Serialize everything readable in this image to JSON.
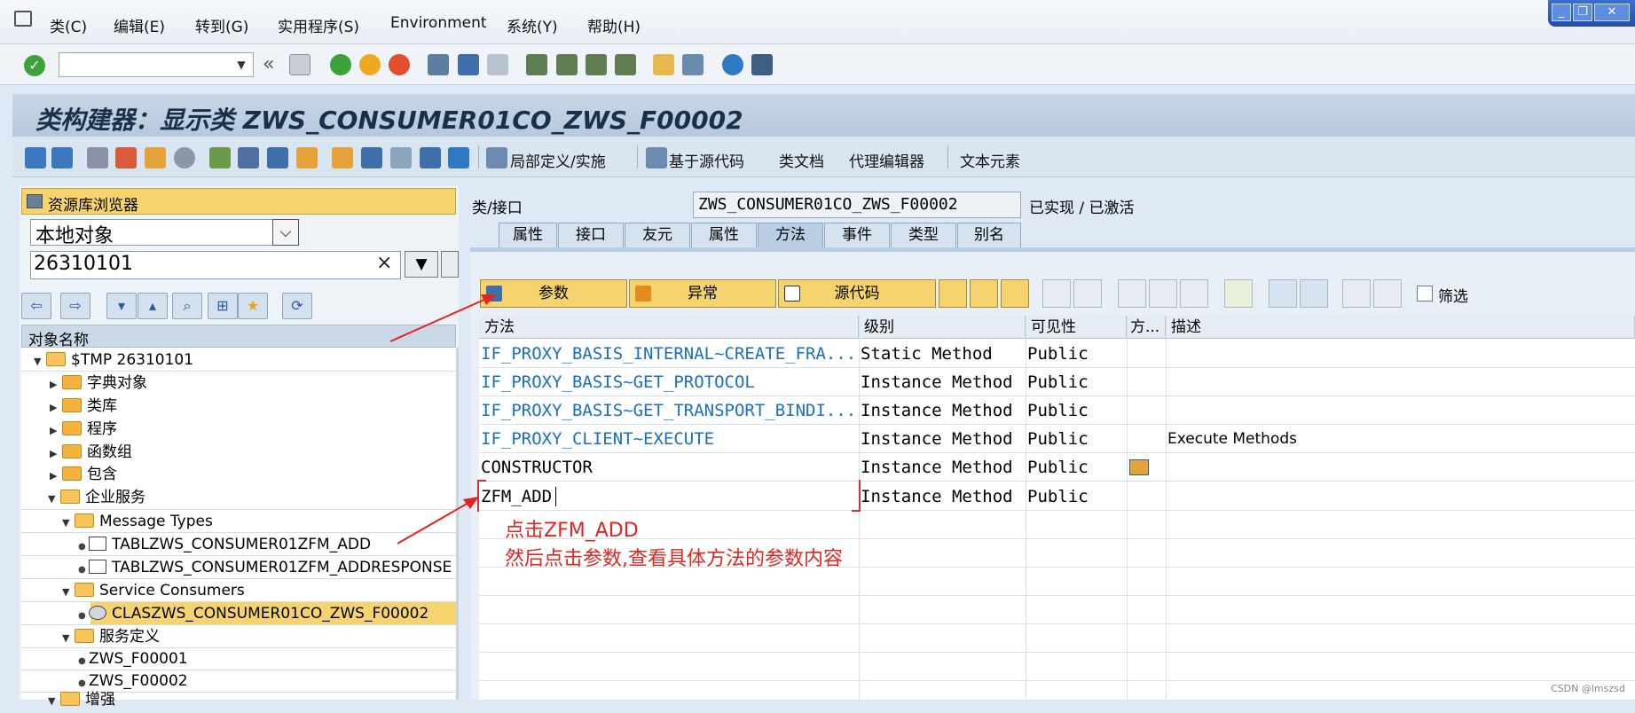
{
  "menu": [
    {
      "label": "类(C)"
    },
    {
      "label": "编辑(E)"
    },
    {
      "label": "转到(G)"
    },
    {
      "label": "实用程序(S)"
    },
    {
      "label": "Environment"
    },
    {
      "label": "系统(Y)"
    },
    {
      "label": "帮助(H)"
    }
  ],
  "title": "类构建器：显示类 ZWS_CONSUMER01CO_ZWS_F00002",
  "app_toolbar": {
    "local_def": "局部定义/实施",
    "source_based": "基于源代码",
    "class_doc": "类文档",
    "proxy_editor": "代理编辑器",
    "text_elements": "文本元素"
  },
  "repo_browser": {
    "title": "资源库浏览器",
    "object_type": "本地对象",
    "search_value": "26310101",
    "clear_glyph": "×",
    "column_header": "对象名称",
    "tree": [
      {
        "label": "$TMP 26310101"
      },
      {
        "label": "字典对象"
      },
      {
        "label": "类库"
      },
      {
        "label": "程序"
      },
      {
        "label": "函数组"
      },
      {
        "label": "包含"
      },
      {
        "label": "企业服务"
      },
      {
        "label": "Message Types"
      },
      {
        "label": "TABLZWS_CONSUMER01ZFM_ADD"
      },
      {
        "label": "TABLZWS_CONSUMER01ZFM_ADDRESPONSE"
      },
      {
        "label": "Service Consumers"
      },
      {
        "label": "CLASZWS_CONSUMER01CO_ZWS_F00002"
      },
      {
        "label": "服务定义"
      },
      {
        "label": "ZWS_F00001"
      },
      {
        "label": "ZWS_F00002"
      },
      {
        "label": "增强"
      }
    ]
  },
  "class_header": {
    "label": "类/接口",
    "value": "ZWS_CONSUMER01CO_ZWS_F00002",
    "status": "已实现 / 已激活"
  },
  "tabs": [
    {
      "label": "属性"
    },
    {
      "label": "接口"
    },
    {
      "label": "友元"
    },
    {
      "label": "属性"
    },
    {
      "label": "方法"
    },
    {
      "label": "事件"
    },
    {
      "label": "类型"
    },
    {
      "label": "别名"
    }
  ],
  "method_toolbar": {
    "params": "参数",
    "exceptions": "异常",
    "source": "源代码",
    "filter": "筛选"
  },
  "grid": {
    "headers": [
      "方法",
      "级别",
      "可见性",
      "方...",
      "描述"
    ],
    "rows": [
      {
        "method": "IF_PROXY_BASIS_INTERNAL~CREATE_FRA...",
        "level": "Static Method",
        "visibility": "Public",
        "desc": ""
      },
      {
        "method": "IF_PROXY_BASIS~GET_PROTOCOL",
        "level": "Instance Method",
        "visibility": "Public",
        "desc": ""
      },
      {
        "method": "IF_PROXY_BASIS~GET_TRANSPORT_BINDI...",
        "level": "Instance Method",
        "visibility": "Public",
        "desc": ""
      },
      {
        "method": "IF_PROXY_CLIENT~EXECUTE",
        "level": "Instance Method",
        "visibility": "Public",
        "desc": "Execute Methods"
      },
      {
        "method": "CONSTRUCTOR",
        "level": "Instance Method",
        "visibility": "Public",
        "desc": ""
      },
      {
        "method": "ZFM_ADD",
        "level": "Instance Method",
        "visibility": "Public",
        "desc": ""
      }
    ]
  },
  "annotation": {
    "line1": "点击ZFM_ADD",
    "line2": "然后点击参数,查看具体方法的参数内容"
  },
  "watermark": "CSDN @lmszsd",
  "colors": {
    "accent": "#f5d36e",
    "link": "#1a6fc0",
    "annotation": "#e0261f"
  }
}
